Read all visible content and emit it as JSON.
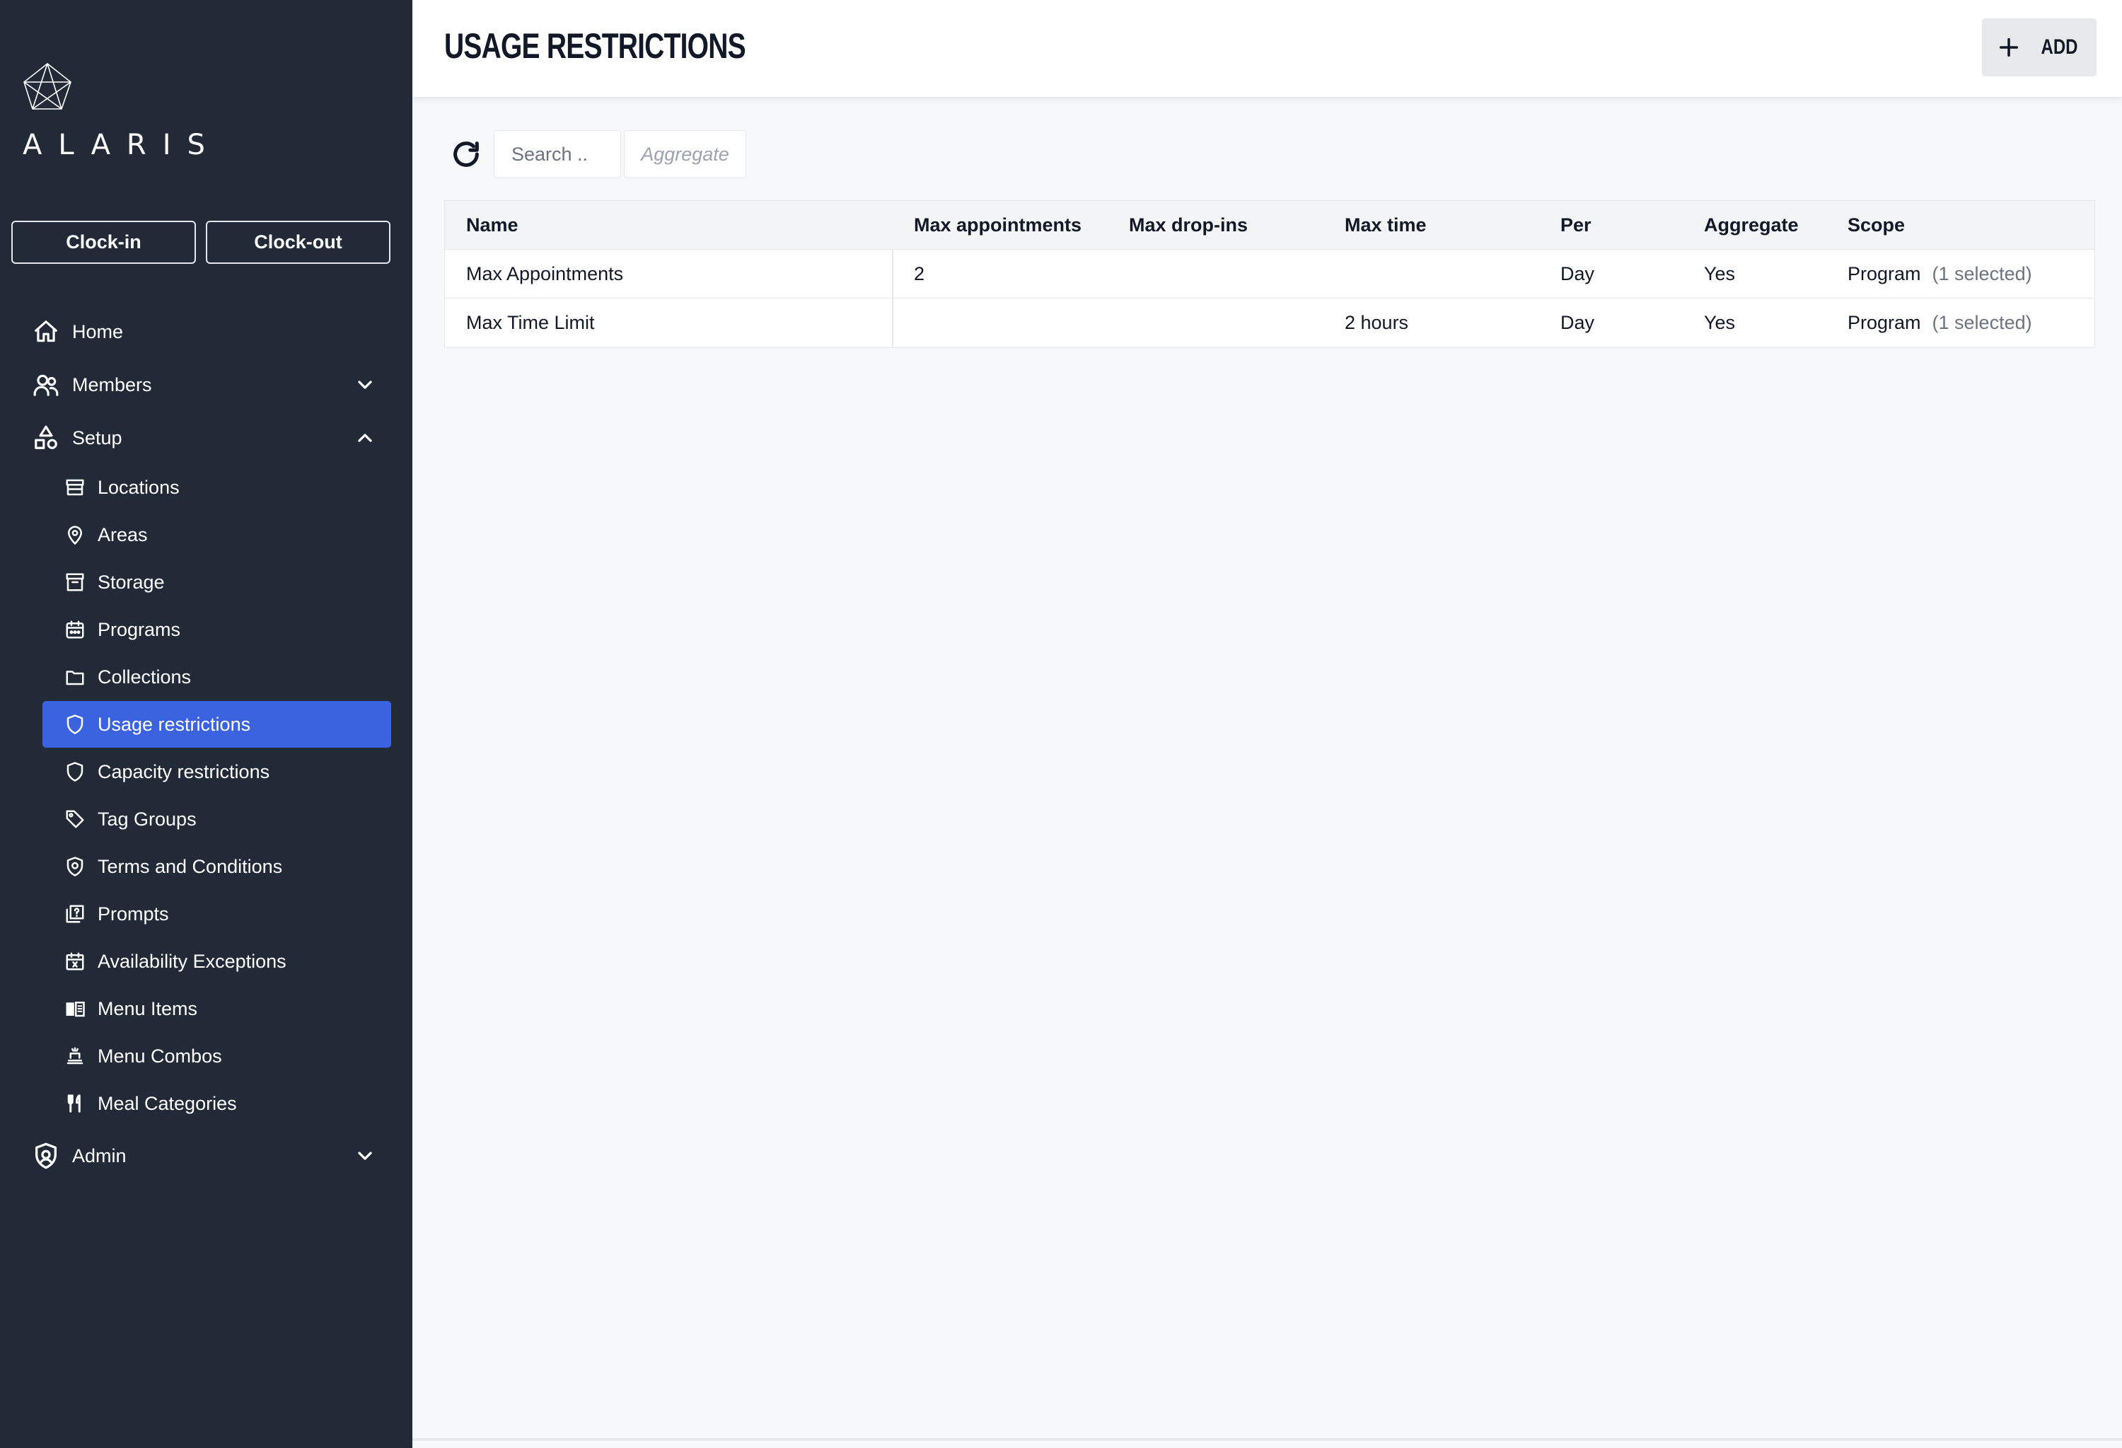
{
  "brand": {
    "name": "ALARIS"
  },
  "clock": {
    "in_label": "Clock-in",
    "out_label": "Clock-out"
  },
  "nav": {
    "home": "Home",
    "members": "Members",
    "setup": "Setup",
    "admin": "Admin",
    "setup_items": [
      {
        "label": "Locations",
        "icon": "store-icon"
      },
      {
        "label": "Areas",
        "icon": "map-pin-icon"
      },
      {
        "label": "Storage",
        "icon": "archive-icon"
      },
      {
        "label": "Programs",
        "icon": "calendar-programs-icon"
      },
      {
        "label": "Collections",
        "icon": "folder-icon"
      },
      {
        "label": "Usage restrictions",
        "icon": "shield-icon"
      },
      {
        "label": "Capacity restrictions",
        "icon": "shield-icon"
      },
      {
        "label": "Tag Groups",
        "icon": "tag-icon"
      },
      {
        "label": "Terms and Conditions",
        "icon": "shield-check-icon"
      },
      {
        "label": "Prompts",
        "icon": "prompt-icon"
      },
      {
        "label": "Availability Exceptions",
        "icon": "calendar-x-icon"
      },
      {
        "label": "Menu Items",
        "icon": "menu-book-icon"
      },
      {
        "label": "Menu Combos",
        "icon": "menu-combo-icon"
      },
      {
        "label": "Meal Categories",
        "icon": "utensils-icon"
      }
    ],
    "active_item": "Usage restrictions",
    "accent_color": "#3b63e0"
  },
  "header": {
    "title": "USAGE RESTRICTIONS",
    "add_label": "ADD"
  },
  "toolbar": {
    "search_placeholder": "Search ..",
    "aggregate_label": "Aggregate"
  },
  "table": {
    "columns": [
      "Name",
      "Max appointments",
      "Max drop-ins",
      "Max time",
      "Per",
      "Aggregate",
      "Scope"
    ],
    "rows": [
      {
        "name": "Max Appointments",
        "max_appointments": "2",
        "max_dropins": "",
        "max_time": "",
        "per": "Day",
        "aggregate": "Yes",
        "scope": "Program",
        "scope_note": "(1 selected)"
      },
      {
        "name": "Max Time Limit",
        "max_appointments": "",
        "max_dropins": "",
        "max_time": "2 hours",
        "per": "Day",
        "aggregate": "Yes",
        "scope": "Program",
        "scope_note": "(1 selected)"
      }
    ]
  }
}
